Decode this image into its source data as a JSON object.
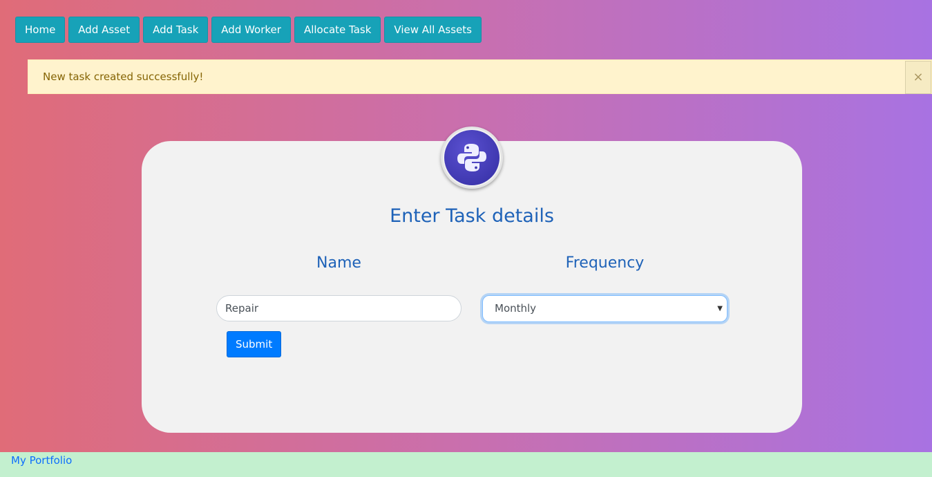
{
  "nav": {
    "items": [
      {
        "label": "Home"
      },
      {
        "label": "Add Asset"
      },
      {
        "label": "Add Task"
      },
      {
        "label": "Add Worker"
      },
      {
        "label": "Allocate Task"
      },
      {
        "label": "View All Assets"
      }
    ]
  },
  "alert": {
    "message": "New task created successfully!",
    "close_glyph": "×"
  },
  "form": {
    "title": "Enter Task details",
    "name_label": "Name",
    "frequency_label": "Frequency",
    "name_value": "Repair",
    "frequency_value": "Monthly",
    "submit_label": "Submit",
    "logo_icon": "python-logo-icon"
  },
  "footer": {
    "link_label": "My Portfolio"
  },
  "colors": {
    "nav_button": "#17a2b8",
    "submit_button": "#007bff",
    "heading": "#1e62b8",
    "alert_bg": "#fff3cd",
    "footer_bg": "#c3f0cf"
  }
}
